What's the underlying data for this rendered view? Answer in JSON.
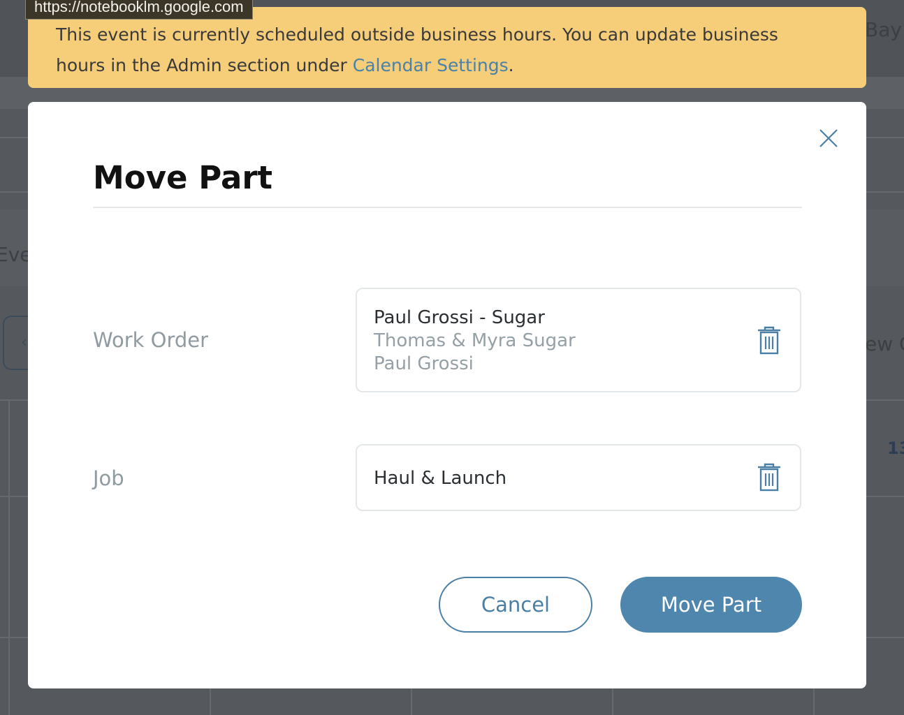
{
  "tooltip": {
    "url": "https://notebooklm.google.com"
  },
  "banner": {
    "text_line1": "This event is currently scheduled outside business hours. You can update business",
    "text_line2_prefix": "hours in the Admin section under ",
    "link_text": "Calendar Settings",
    "text_line2_suffix": "."
  },
  "background": {
    "top_right_text": "Bay",
    "left_partial_text": "Eve",
    "right_partial_text": "ew C",
    "right_number_partial": "13",
    "back_arrow": "‹"
  },
  "modal": {
    "title": "Move Part",
    "close_icon": "close-icon",
    "fields": {
      "work_order": {
        "label": "Work Order",
        "title": "Paul Grossi - Sugar",
        "line2": "Thomas & Myra Sugar",
        "line3": "Paul Grossi",
        "remove_icon": "trash-icon"
      },
      "job": {
        "label": "Job",
        "value": "Haul & Launch",
        "remove_icon": "trash-icon"
      }
    },
    "buttons": {
      "cancel": "Cancel",
      "confirm": "Move Part"
    }
  },
  "colors": {
    "banner_bg": "#f6cd79",
    "link": "#4a82a8",
    "primary_button": "#4f86ad",
    "overlay": "#55585c"
  }
}
